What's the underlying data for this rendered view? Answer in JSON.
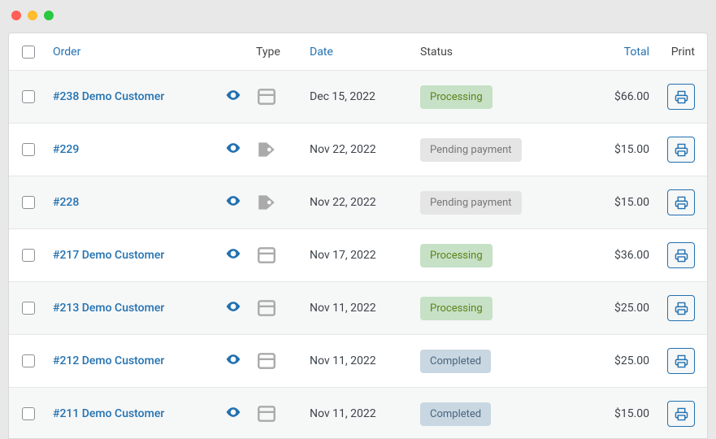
{
  "headers": {
    "order": "Order",
    "type": "Type",
    "date": "Date",
    "status": "Status",
    "total": "Total",
    "print": "Print"
  },
  "status_classes": {
    "Processing": "badge-processing",
    "Pending payment": "badge-pending",
    "Completed": "badge-completed"
  },
  "orders": [
    {
      "label": "#238 Demo Customer",
      "type_icon": "window",
      "date": "Dec 15, 2022",
      "status": "Processing",
      "total": "$66.00"
    },
    {
      "label": "#229",
      "type_icon": "tag",
      "date": "Nov 22, 2022",
      "status": "Pending payment",
      "total": "$15.00"
    },
    {
      "label": "#228",
      "type_icon": "tag",
      "date": "Nov 22, 2022",
      "status": "Pending payment",
      "total": "$15.00"
    },
    {
      "label": "#217 Demo Customer",
      "type_icon": "window",
      "date": "Nov 17, 2022",
      "status": "Processing",
      "total": "$36.00"
    },
    {
      "label": "#213 Demo Customer",
      "type_icon": "window",
      "date": "Nov 11, 2022",
      "status": "Processing",
      "total": "$25.00"
    },
    {
      "label": "#212 Demo Customer",
      "type_icon": "window",
      "date": "Nov 11, 2022",
      "status": "Completed",
      "total": "$25.00"
    },
    {
      "label": "#211 Demo Customer",
      "type_icon": "window",
      "date": "Nov 11, 2022",
      "status": "Completed",
      "total": "$15.00"
    }
  ]
}
